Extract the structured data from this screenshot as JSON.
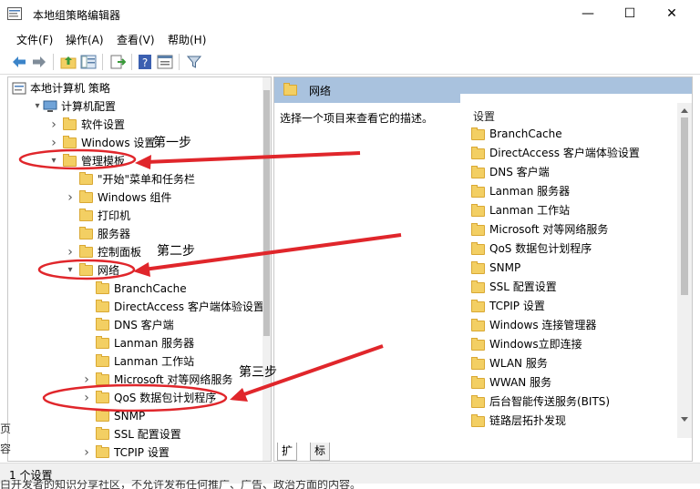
{
  "window": {
    "title": "本地组策略编辑器",
    "controls": {
      "minimize": "—",
      "maximize": "☐",
      "close": "✕"
    }
  },
  "menu": [
    "文件(F)",
    "操作(A)",
    "查看(V)",
    "帮助(H)"
  ],
  "toolbar": [
    "back-icon",
    "forward-icon",
    "up-folder-icon",
    "show-hide-tree-icon",
    "export-list-icon",
    "help-icon",
    "properties-icon",
    "filter-icon"
  ],
  "tree": [
    {
      "label": "本地计算机 策略",
      "level": 0,
      "expander": "none"
    },
    {
      "label": "计算机配置",
      "level": 1,
      "expander": "expanded"
    },
    {
      "label": "软件设置",
      "level": 2,
      "expander": "collapsed"
    },
    {
      "label": "Windows 设置",
      "level": 2,
      "expander": "collapsed"
    },
    {
      "label": "管理模板",
      "level": 2,
      "expander": "expanded"
    },
    {
      "label": "\"开始\"菜单和任务栏",
      "level": 3,
      "expander": "none"
    },
    {
      "label": "Windows 组件",
      "level": 3,
      "expander": "collapsed"
    },
    {
      "label": "打印机",
      "level": 3,
      "expander": "none"
    },
    {
      "label": "服务器",
      "level": 3,
      "expander": "none"
    },
    {
      "label": "控制面板",
      "level": 3,
      "expander": "collapsed"
    },
    {
      "label": "网络",
      "level": 3,
      "expander": "expanded"
    },
    {
      "label": "BranchCache",
      "level": 4,
      "expander": "none"
    },
    {
      "label": "DirectAccess 客户端体验设置",
      "level": 4,
      "expander": "none"
    },
    {
      "label": "DNS 客户端",
      "level": 4,
      "expander": "none"
    },
    {
      "label": "Lanman 服务器",
      "level": 4,
      "expander": "none"
    },
    {
      "label": "Lanman 工作站",
      "level": 4,
      "expander": "none"
    },
    {
      "label": "Microsoft 对等网络服务",
      "level": 4,
      "expander": "collapsed"
    },
    {
      "label": "QoS 数据包计划程序",
      "level": 4,
      "expander": "collapsed"
    },
    {
      "label": "SNMP",
      "level": 4,
      "expander": "none"
    },
    {
      "label": "SSL 配置设置",
      "level": 4,
      "expander": "none"
    },
    {
      "label": "TCPIP 设置",
      "level": 4,
      "expander": "collapsed"
    }
  ],
  "right": {
    "header": "网络",
    "description": "选择一个项目来查看它的描述。",
    "column_header": "设置",
    "items": [
      "BranchCache",
      "DirectAccess 客户端体验设置",
      "DNS 客户端",
      "Lanman 服务器",
      "Lanman 工作站",
      "Microsoft 对等网络服务",
      "QoS 数据包计划程序",
      "SNMP",
      "SSL 配置设置",
      "TCPIP 设置",
      "Windows 连接管理器",
      "Windows立即连接",
      "WLAN 服务",
      "WWAN 服务",
      "后台智能传送服务(BITS)",
      "链路层拓扑发现"
    ],
    "tabs": [
      "扩展",
      "标准"
    ]
  },
  "status": "1 个设置",
  "annotations": {
    "step1": "第一步",
    "step2": "第二步",
    "step3": "第三步"
  },
  "background_text": "白开发者的知识分享社区，不允许发布任何推广、广告、政治方面的内容。",
  "side_fragments": [
    "页",
    "容"
  ],
  "colors": {
    "annotation_red": "#e0262b",
    "header_blue": "#a9c2de",
    "folder_yellow": "#f3cf63"
  }
}
